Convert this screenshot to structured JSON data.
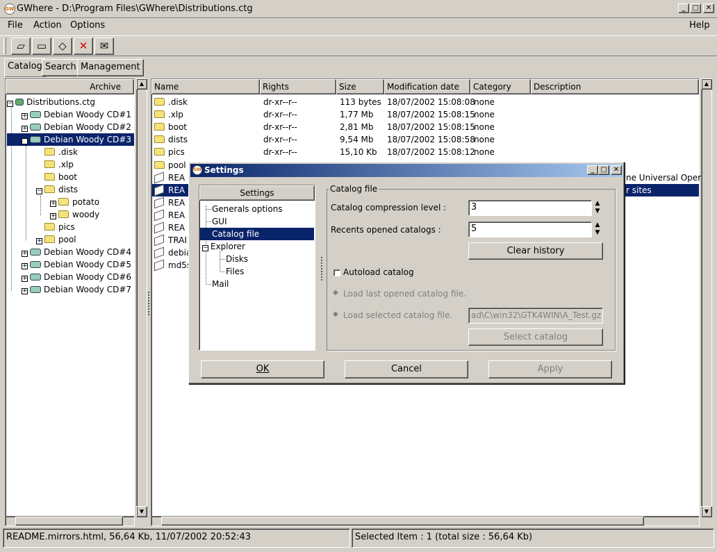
{
  "window": {
    "title": "GWhere - D:\\Program Files\\GWhere\\Distributions.ctg",
    "icon": "gwhere-app-icon",
    "controls": [
      "_",
      "□",
      "✕"
    ]
  },
  "menu": {
    "file": "File",
    "action": "Action",
    "options": "Options",
    "help": "Help"
  },
  "toolbar": {
    "buttons": [
      "new-catalog-icon",
      "open-catalog-icon",
      "save-catalog-icon",
      "close-catalog-icon",
      "mail-icon"
    ]
  },
  "tabs": {
    "catalog": "Catalog",
    "search": "Search",
    "management": "Management"
  },
  "tree": {
    "header": "Archive",
    "root": "Distributions.ctg",
    "cds_before": [
      "Debian Woody CD#1",
      "Debian Woody CD#2"
    ],
    "selected_cd": "Debian Woody CD#3",
    "folders": [
      ".disk",
      ".xlp",
      "boot",
      "dists",
      "pics",
      "pool"
    ],
    "dists_children": [
      "potato",
      "woody"
    ],
    "cds_after": [
      "Debian Woody CD#4",
      "Debian Woody CD#5",
      "Debian Woody CD#6",
      "Debian Woody CD#7"
    ]
  },
  "list": {
    "columns": {
      "name": "Name",
      "rights": "Rights",
      "size": "Size",
      "modified": "Modification date",
      "category": "Category",
      "description": "Description"
    },
    "rows": [
      {
        "name": ".disk",
        "rights": "dr-xr--r--",
        "size": "113 bytes",
        "date": "18/07/2002 15:08:08",
        "category": "none"
      },
      {
        "name": ".xlp",
        "rights": "dr-xr--r--",
        "size": "1,77 Mb",
        "date": "18/07/2002 15:08:15",
        "category": "none"
      },
      {
        "name": "boot",
        "rights": "dr-xr--r--",
        "size": "2,81 Mb",
        "date": "18/07/2002 15:08:15",
        "category": "none"
      },
      {
        "name": "dists",
        "rights": "dr-xr--r--",
        "size": "9,54 Mb",
        "date": "18/07/2002 15:08:58",
        "category": "none"
      },
      {
        "name": "pics",
        "rights": "dr-xr--r--",
        "size": "15,10 Kb",
        "date": "18/07/2002 15:08:12",
        "category": "none"
      }
    ],
    "partial_rows": [
      "pool",
      "REA",
      "REA",
      "REA",
      "REA",
      "REA",
      "TRAI",
      "debia",
      "md5s"
    ],
    "desc_fragment_1": "ne Universal Opera",
    "desc_fragment_2": "r sites"
  },
  "status": {
    "left": "README.mirrors.html, 56,64 Kb, 11/07/2002 20:52:43",
    "right": "Selected Item : 1 (total size : 56,64 Kb)"
  },
  "dialog": {
    "title": "Settings",
    "controls": [
      "_",
      "□",
      "✕"
    ],
    "tree_header": "Settings",
    "tree_items": {
      "general": "Generals options",
      "gui": "GUI",
      "catalog": "Catalog file",
      "explorer": "Explorer",
      "disks": "Disks",
      "files": "Files",
      "mail": "Mail"
    },
    "group": "Catalog file",
    "compression_label": "Catalog compression level :",
    "compression_value": "3",
    "recents_label": "Recents opened catalogs :",
    "recents_value": "5",
    "clear_history": "Clear history",
    "autoload": "Autoload catalog",
    "load_last": "Load last opened catalog file.",
    "load_selected": "Load selected catalog file.",
    "catalog_path": "ad\\C\\win32\\GTK4WIN\\A_Test.gz",
    "select_catalog": "Select catalog",
    "ok": "OK",
    "cancel": "Cancel",
    "apply": "Apply"
  }
}
